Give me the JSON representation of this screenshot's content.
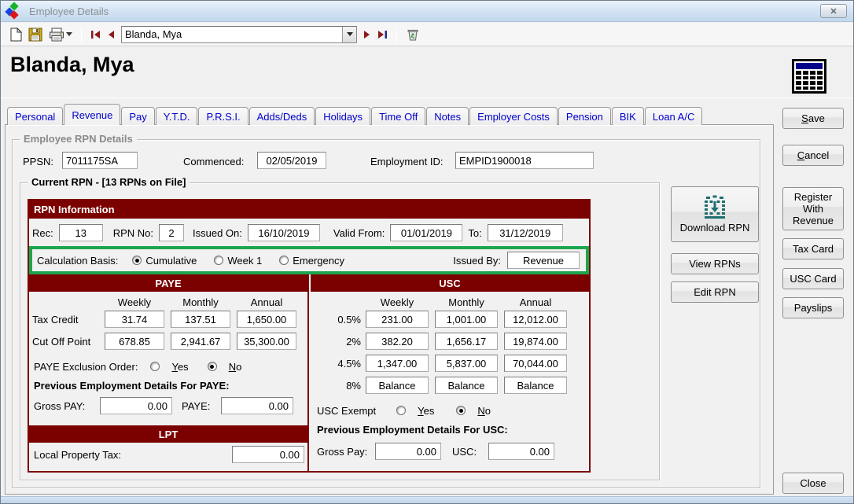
{
  "window": {
    "title": "Employee Details",
    "close_glyph": "✕"
  },
  "toolbar": {
    "record_selector_value": "Blanda, Mya"
  },
  "header": {
    "employee_name": "Blanda, Mya"
  },
  "tabs": [
    "Personal",
    "Revenue",
    "Pay",
    "Y.T.D.",
    "P.R.S.I.",
    "Adds/Deds",
    "Holidays",
    "Time Off",
    "Notes",
    "Employer Costs",
    "Pension",
    "BIK",
    "Loan A/C"
  ],
  "active_tab": "Revenue",
  "employee_rpn": {
    "group_label": "Employee RPN Details",
    "ppsn_label": "PPSN:",
    "ppsn_value": "7011175SA",
    "commenced_label": "Commenced:",
    "commenced_value": "02/05/2019",
    "employment_id_label": "Employment ID:",
    "employment_id_value": "EMPID1900018"
  },
  "current_rpn": {
    "group_label": "Current RPN - [13 RPNs on File]",
    "info_header": "RPN Information",
    "rec_label": "Rec:",
    "rec_value": "13",
    "rpn_no_label": "RPN No:",
    "rpn_no_value": "2",
    "issued_on_label": "Issued On:",
    "issued_on_value": "16/10/2019",
    "valid_from_label": "Valid From:",
    "valid_from_value": "01/01/2019",
    "to_label": "To:",
    "to_value": "31/12/2019",
    "calc_basis_label": "Calculation Basis:",
    "calc_options": [
      "Cumulative",
      "Week 1",
      "Emergency"
    ],
    "calc_selected": "Cumulative",
    "issued_by_label": "Issued By:",
    "issued_by_value": "Revenue"
  },
  "paye": {
    "header": "PAYE",
    "columns": [
      "Weekly",
      "Monthly",
      "Annual"
    ],
    "rows": [
      {
        "label": "Tax Credit",
        "values": [
          "31.74",
          "137.51",
          "1,650.00"
        ]
      },
      {
        "label": "Cut Off Point",
        "values": [
          "678.85",
          "2,941.67",
          "35,300.00"
        ]
      }
    ],
    "exclusion_label": "PAYE Exclusion Order:",
    "yes_label": "Yes",
    "no_label": "No",
    "exclusion_selected": "No",
    "prev_header": "Previous Employment Details For PAYE:",
    "gross_label": "Gross PAY:",
    "gross_value": "0.00",
    "paye_label": "PAYE:",
    "paye_value": "0.00"
  },
  "lpt": {
    "header": "LPT",
    "label": "Local Property Tax:",
    "value": "0.00"
  },
  "usc": {
    "header": "USC",
    "columns": [
      "Weekly",
      "Monthly",
      "Annual"
    ],
    "rows": [
      {
        "label": "0.5%",
        "values": [
          "231.00",
          "1,001.00",
          "12,012.00"
        ]
      },
      {
        "label": "2%",
        "values": [
          "382.20",
          "1,656.17",
          "19,874.00"
        ]
      },
      {
        "label": "4.5%",
        "values": [
          "1,347.00",
          "5,837.00",
          "70,044.00"
        ]
      },
      {
        "label": "8%",
        "values": [
          "Balance",
          "Balance",
          "Balance"
        ]
      }
    ],
    "exempt_label": "USC Exempt",
    "yes_label": "Yes",
    "no_label": "No",
    "exempt_selected": "No",
    "prev_header": "Previous Employment Details For USC:",
    "gross_label": "Gross Pay:",
    "gross_value": "0.00",
    "usc_label": "USC:",
    "usc_value": "0.00"
  },
  "rpn_actions": {
    "download": "Download RPN",
    "view": "View RPNs",
    "edit": "Edit RPN"
  },
  "side_buttons": {
    "save": "Save",
    "cancel": "Cancel",
    "register": "Register With Revenue",
    "tax_card": "Tax Card",
    "usc_card": "USC Card",
    "payslips": "Payslips",
    "close": "Close"
  },
  "colors": {
    "maroon": "#7B0000",
    "annotation_green": "#1CA64C",
    "tab_text": "#0000CE"
  }
}
